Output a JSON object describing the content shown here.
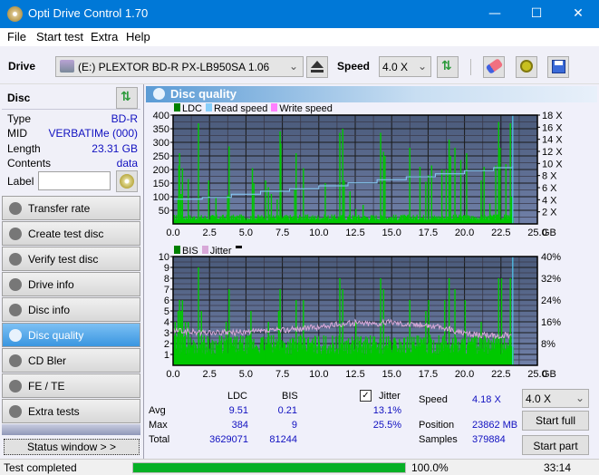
{
  "window": {
    "title": "Opti Drive Control 1.70",
    "minimize": "—",
    "maximize": "☐",
    "close": "✕"
  },
  "menu": [
    "File",
    "Start test",
    "Extra",
    "Help"
  ],
  "toolbar": {
    "drive_label": "Drive",
    "drive_value": "(E:)  PLEXTOR BD-R  PX-LB950SA 1.06",
    "speed_label": "Speed",
    "speed_value": "4.0 X"
  },
  "disc": {
    "title": "Disc",
    "rows": [
      {
        "label": "Type",
        "value": "BD-R"
      },
      {
        "label": "MID",
        "value": "VERBATIMe (000)"
      },
      {
        "label": "Length",
        "value": "23.31 GB"
      },
      {
        "label": "Contents",
        "value": "data"
      }
    ],
    "label_field_label": "Label",
    "label_field_value": ""
  },
  "nav": [
    {
      "label": "Transfer rate",
      "active": false
    },
    {
      "label": "Create test disc",
      "active": false
    },
    {
      "label": "Verify test disc",
      "active": false
    },
    {
      "label": "Drive info",
      "active": false
    },
    {
      "label": "Disc info",
      "active": false
    },
    {
      "label": "Disc quality",
      "active": true
    },
    {
      "label": "CD Bler",
      "active": false
    },
    {
      "label": "FE / TE",
      "active": false
    },
    {
      "label": "Extra tests",
      "active": false
    }
  ],
  "status_window_button": "Status window > >",
  "panel": {
    "title": "Disc quality"
  },
  "chart_data": [
    {
      "type": "bar",
      "title": "LDC",
      "legend": [
        {
          "name": "LDC",
          "color": "#008000"
        },
        {
          "name": "Read speed",
          "color": "#87cefa"
        },
        {
          "name": "Write speed",
          "color": "#ff80ff"
        }
      ],
      "xlabel": "GB",
      "xlim": [
        0,
        25
      ],
      "x_ticks": [
        "0.0",
        "2.5",
        "5.0",
        "7.5",
        "10.0",
        "12.5",
        "15.0",
        "17.5",
        "20.0",
        "22.5",
        "25.0"
      ],
      "ylim": [
        0,
        400
      ],
      "y_ticks": [
        "50",
        "100",
        "150",
        "200",
        "250",
        "300",
        "350",
        "400"
      ],
      "y2lim": [
        0,
        18
      ],
      "y2_ticks": [
        "2 X",
        "4 X",
        "6 X",
        "8 X",
        "10 X",
        "12 X",
        "14 X",
        "16 X",
        "18 X"
      ],
      "grid": true,
      "end_marker_gb": 23.31,
      "series": [
        {
          "name": "LDC",
          "color": "#00c800",
          "spikes": [
            [
              0.3,
              95
            ],
            [
              0.35,
              215
            ],
            [
              0.4,
              260
            ],
            [
              0.5,
              110
            ],
            [
              0.6,
              205
            ],
            [
              1.0,
              165
            ],
            [
              1.7,
              370
            ],
            [
              2.4,
              160
            ],
            [
              2.9,
              95
            ],
            [
              3.7,
              105
            ],
            [
              3.8,
              285
            ],
            [
              5.4,
              205
            ],
            [
              5.5,
              150
            ],
            [
              6.3,
              160
            ],
            [
              6.5,
              135
            ],
            [
              6.7,
              110
            ],
            [
              7.1,
              90
            ],
            [
              7.3,
              340
            ],
            [
              7.35,
              295
            ],
            [
              8.3,
              125
            ],
            [
              8.4,
              260
            ],
            [
              8.9,
              205
            ],
            [
              10.4,
              150
            ],
            [
              11.4,
              335
            ],
            [
              11.6,
              350
            ],
            [
              11.7,
              160
            ],
            [
              12.1,
              120
            ],
            [
              12.5,
              55
            ],
            [
              13.0,
              70
            ],
            [
              14.2,
              335
            ],
            [
              14.4,
              265
            ],
            [
              14.5,
              250
            ],
            [
              16.2,
              280
            ],
            [
              16.9,
              210
            ],
            [
              17.3,
              155
            ],
            [
              17.5,
              180
            ],
            [
              17.7,
              215
            ],
            [
              18.4,
              200
            ],
            [
              18.7,
              200
            ],
            [
              18.9,
              310
            ],
            [
              19.3,
              280
            ],
            [
              19.0,
              250
            ],
            [
              19.7,
              235
            ],
            [
              20.1,
              260
            ],
            [
              21.1,
              160
            ],
            [
              21.3,
              210
            ],
            [
              21.7,
              75
            ],
            [
              22.1,
              215
            ],
            [
              22.3,
              375
            ],
            [
              22.4,
              280
            ],
            [
              22.8,
              220
            ],
            [
              23.1,
              370
            ],
            [
              23.2,
              100
            ]
          ],
          "baseline": 25
        },
        {
          "name": "Read speed",
          "color": "#87cefa",
          "unit": "X",
          "points": [
            [
              0,
              4.1
            ],
            [
              2,
              4.4
            ],
            [
              4,
              4.9
            ],
            [
              6,
              5.4
            ],
            [
              8,
              5.8
            ],
            [
              10,
              6.3
            ],
            [
              12,
              6.8
            ],
            [
              14,
              7.3
            ],
            [
              16,
              7.8
            ],
            [
              18,
              8.3
            ],
            [
              20,
              8.8
            ],
            [
              22,
              9.3
            ],
            [
              23.3,
              9.6
            ]
          ]
        }
      ]
    },
    {
      "type": "bar",
      "title": "BIS",
      "legend": [
        {
          "name": "BIS",
          "color": "#008000"
        },
        {
          "name": "Jitter",
          "color": "#d8a8d8"
        }
      ],
      "xlabel": "GB",
      "xlim": [
        0,
        25
      ],
      "x_ticks": [
        "0.0",
        "2.5",
        "5.0",
        "7.5",
        "10.0",
        "12.5",
        "15.0",
        "17.5",
        "20.0",
        "22.5",
        "25.0"
      ],
      "ylim": [
        0,
        10
      ],
      "y_ticks": [
        "1",
        "2",
        "3",
        "4",
        "5",
        "6",
        "7",
        "8",
        "9",
        "10"
      ],
      "y2lim": [
        0,
        40
      ],
      "y2_ticks": [
        "8%",
        "16%",
        "24%",
        "32%",
        "40%"
      ],
      "grid": true,
      "end_marker_gb": 23.31,
      "series": [
        {
          "name": "BIS",
          "color": "#00c800",
          "spikes": [
            [
              0.3,
              5
            ],
            [
              0.4,
              6
            ],
            [
              0.5,
              5
            ],
            [
              0.6,
              6
            ],
            [
              0.1,
              4
            ],
            [
              0.8,
              4
            ],
            [
              1.0,
              4
            ],
            [
              1.7,
              9
            ],
            [
              1.9,
              5
            ],
            [
              3.8,
              7
            ],
            [
              3.6,
              4
            ],
            [
              5.3,
              5
            ],
            [
              6.5,
              4
            ],
            [
              7.3,
              7
            ],
            [
              7.2,
              5
            ],
            [
              8.4,
              6
            ],
            [
              8.9,
              6
            ],
            [
              11.4,
              8
            ],
            [
              11.6,
              7
            ],
            [
              12.5,
              4
            ],
            [
              14.2,
              8
            ],
            [
              14.4,
              7
            ],
            [
              16.2,
              6
            ],
            [
              17.3,
              5
            ],
            [
              17.5,
              6
            ],
            [
              18.9,
              8
            ],
            [
              19.3,
              7
            ],
            [
              18.6,
              6
            ],
            [
              20.0,
              6
            ],
            [
              21.1,
              4
            ],
            [
              22.3,
              8
            ],
            [
              22.5,
              8
            ],
            [
              23.1,
              8
            ]
          ],
          "baseline": 2
        },
        {
          "name": "Jitter",
          "color": "#d8a8d8",
          "unit": "%",
          "points": [
            [
              0,
              12.8
            ],
            [
              1,
              12.4
            ],
            [
              2,
              12.0
            ],
            [
              4,
              12.0
            ],
            [
              6,
              12.4
            ],
            [
              8,
              13.2
            ],
            [
              10,
              14.0
            ],
            [
              11.5,
              15.2
            ],
            [
              12.5,
              15.6
            ],
            [
              14,
              15.4
            ],
            [
              15,
              16.0
            ],
            [
              16,
              15.2
            ],
            [
              17.5,
              14.8
            ],
            [
              19,
              13.2
            ],
            [
              20,
              11.6
            ],
            [
              21,
              11.2
            ],
            [
              22,
              10.8
            ],
            [
              23.2,
              11.0
            ]
          ]
        }
      ]
    }
  ],
  "stats": {
    "headers": [
      "LDC",
      "BIS"
    ],
    "rows": [
      {
        "label": "Avg",
        "ldc": "9.51",
        "bis": "0.21",
        "jitter": "13.1%"
      },
      {
        "label": "Max",
        "ldc": "384",
        "bis": "9",
        "jitter": "25.5%"
      },
      {
        "label": "Total",
        "ldc": "3629071",
        "bis": "81244",
        "jitter": ""
      }
    ],
    "jitter_label": "Jitter",
    "jitter_checked": true,
    "speed_label": "Speed",
    "speed_value": "4.18 X",
    "position_label": "Position",
    "position_value": "23862 MB",
    "samples_label": "Samples",
    "samples_value": "379884",
    "speed_select": "4.0 X",
    "start_full": "Start full",
    "start_part": "Start part"
  },
  "status": {
    "text": "Test completed",
    "progress": 1.0,
    "progress_text": "100.0%",
    "time": "33:14"
  }
}
